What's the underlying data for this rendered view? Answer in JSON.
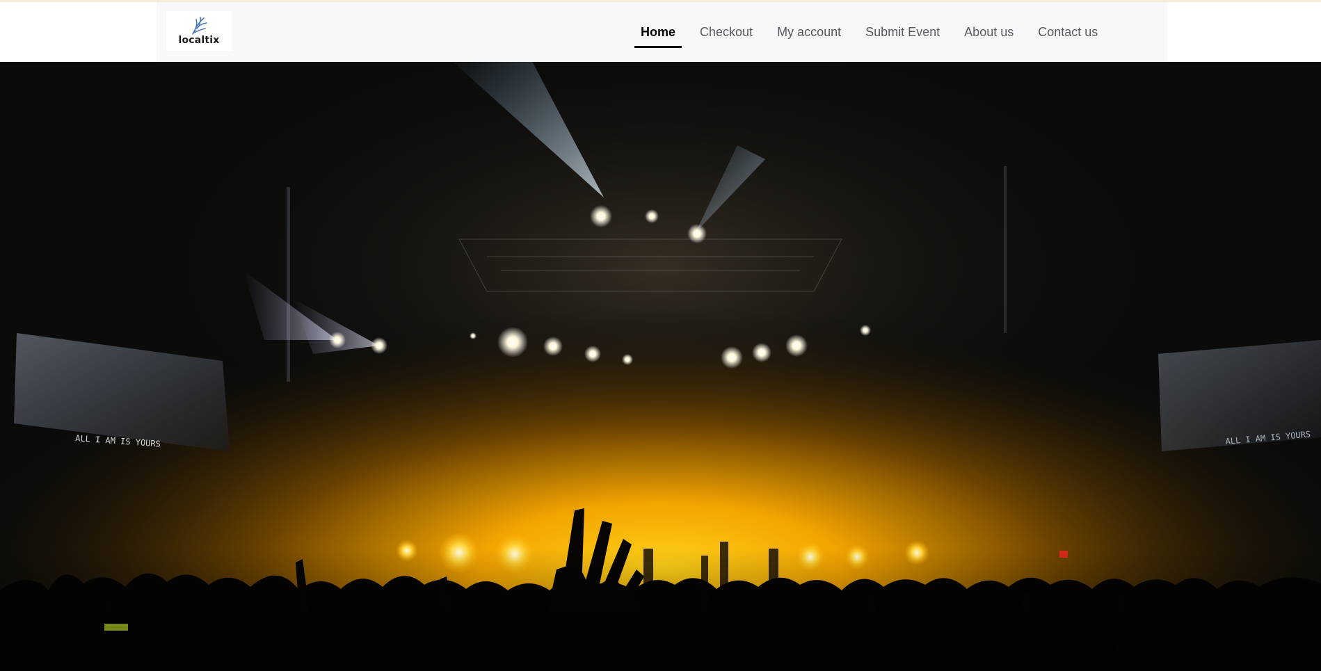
{
  "brand": {
    "name": "localtix"
  },
  "nav": {
    "items": [
      {
        "label": "Home",
        "active": true
      },
      {
        "label": "Checkout"
      },
      {
        "label": "My account"
      },
      {
        "label": "Submit Event"
      },
      {
        "label": "About us"
      },
      {
        "label": "Contact us"
      }
    ]
  },
  "hero": {
    "screen_text_left": "ALL I AM IS YOURS",
    "screen_text_right": "ALL I AM IS YOURS"
  },
  "colors": {
    "header_bg": "#f7f8fa",
    "active_underline": "#000000",
    "stage_glow": "#f5b400"
  }
}
